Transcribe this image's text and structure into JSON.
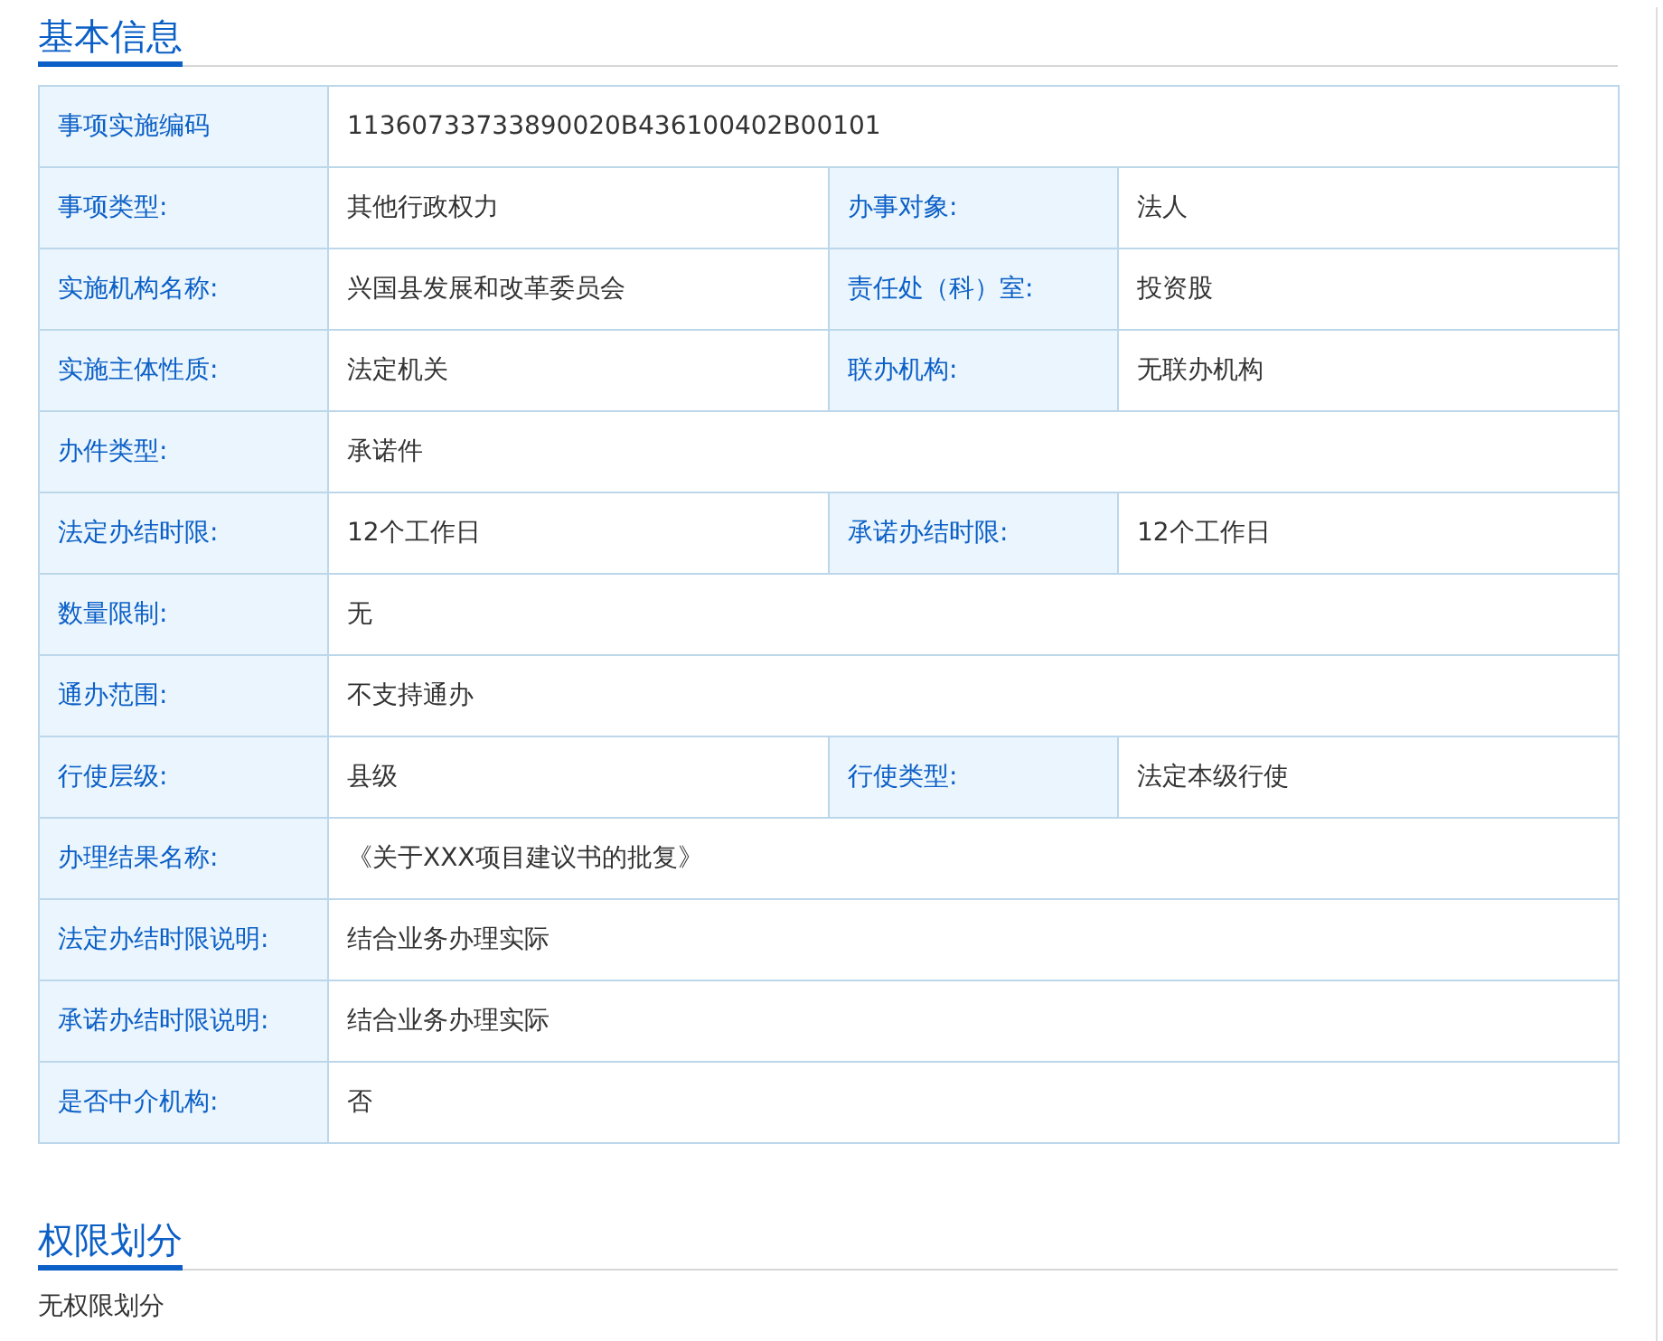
{
  "sections": [
    {
      "title": "基本信息",
      "rows": [
        [
          {
            "label": "事项实施编码",
            "value": "11360733733890020B436100402B00101"
          }
        ],
        [
          {
            "label": "事项类型:",
            "value": "其他行政权力"
          },
          {
            "label": "办事对象:",
            "value": "法人"
          }
        ],
        [
          {
            "label": "实施机构名称:",
            "value": "兴国县发展和改革委员会"
          },
          {
            "label": "责任处（科）室:",
            "value": "投资股"
          }
        ],
        [
          {
            "label": "实施主体性质:",
            "value": "法定机关"
          },
          {
            "label": "联办机构:",
            "value": "无联办机构"
          }
        ],
        [
          {
            "label": "办件类型:",
            "value": "承诺件"
          }
        ],
        [
          {
            "label": "法定办结时限:",
            "value": "12个工作日"
          },
          {
            "label": "承诺办结时限:",
            "value": "12个工作日"
          }
        ],
        [
          {
            "label": "数量限制:",
            "value": "无"
          }
        ],
        [
          {
            "label": "通办范围:",
            "value": "不支持通办"
          }
        ],
        [
          {
            "label": "行使层级:",
            "value": "县级"
          },
          {
            "label": "行使类型:",
            "value": "法定本级行使"
          }
        ],
        [
          {
            "label": "办理结果名称:",
            "value": "《关于XXX项目建议书的批复》"
          }
        ],
        [
          {
            "label": "法定办结时限说明:",
            "value": "结合业务办理实际"
          }
        ],
        [
          {
            "label": "承诺办结时限说明:",
            "value": "结合业务办理实际"
          }
        ],
        [
          {
            "label": "是否中介机构:",
            "value": "否"
          }
        ]
      ]
    },
    {
      "title": "权限划分",
      "text": "无权限划分"
    }
  ]
}
